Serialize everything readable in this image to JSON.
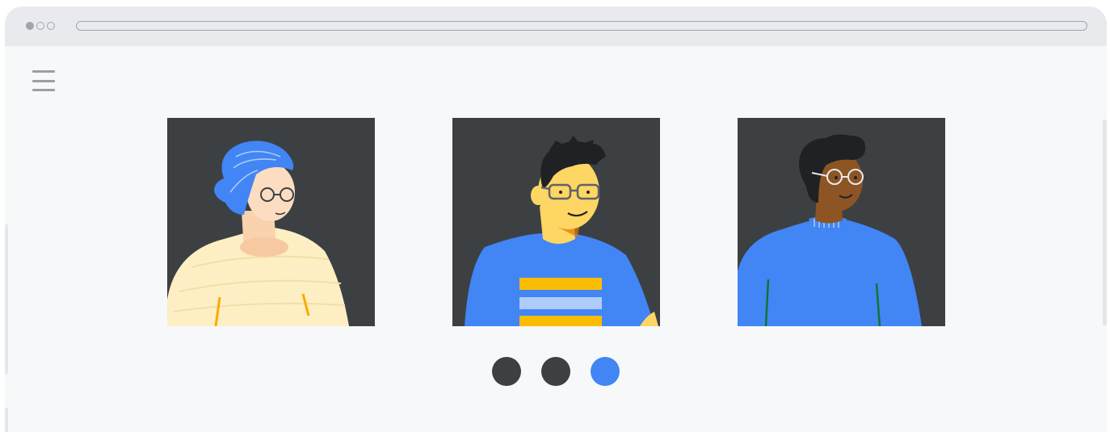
{
  "window": {
    "traffic_lights": [
      "filled",
      "outline",
      "outline"
    ]
  },
  "menu": {
    "icon": "hamburger-menu-icon"
  },
  "carousel": {
    "slides": [
      {
        "name": "avatar-woman-blue-hair",
        "shirt_color": "#fdefc3",
        "hair_color": "#4285f4"
      },
      {
        "name": "avatar-man-striped-shirt",
        "shirt_color": "#4285f4",
        "hair_color": "#202124"
      },
      {
        "name": "avatar-man-blue-sweater",
        "shirt_color": "#4285f4",
        "hair_color": "#202124"
      }
    ],
    "active_index": 2,
    "dot_count": 3,
    "colors": {
      "dot_inactive": "#3c4043",
      "dot_active": "#4285f4",
      "card_background": "#3c4043"
    }
  }
}
